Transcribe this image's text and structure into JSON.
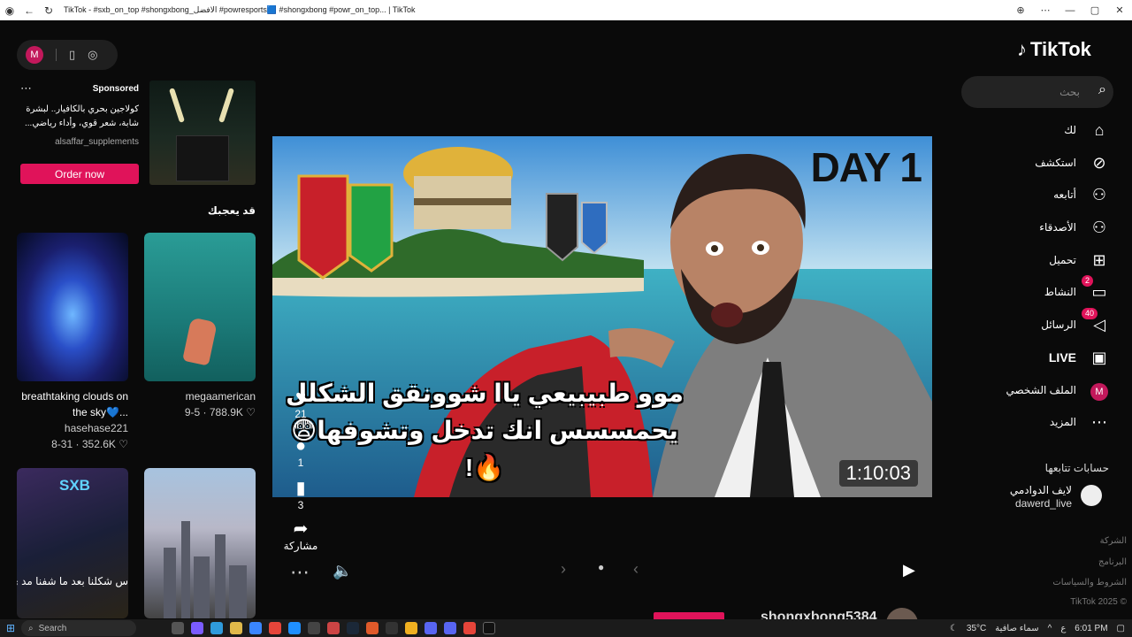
{
  "browser": {
    "title": "TikTok - #sxb_on_top #shongxbong_الافضل #powresports🟦 #shongxbong #powr_on_top... | TikTok",
    "icons": [
      "tiktok-app-icon",
      "back-icon",
      "refresh-icon",
      "zoom-icon",
      "more-icon",
      "minimize-icon",
      "restore-icon",
      "close-icon"
    ]
  },
  "top_pill": {
    "avatar_initial": "M"
  },
  "ad": {
    "sponsored": "Sponsored",
    "description": "كولاجين بحري بالكافيار.. لبشرة شابة، شعر قوي، وأداء رياضي...",
    "brand": "alsaffar_supplements",
    "cta": "Order now"
  },
  "suggested": {
    "title": "قد يعجبك",
    "items": [
      {
        "caption": "breathtaking clouds on the sky💙...",
        "author": "hasehase221",
        "date": "8-31",
        "likes": "352.6K"
      },
      {
        "caption": "megaamerican",
        "author": "",
        "date": "9-5",
        "likes": "788.9K"
      },
      {
        "caption": "س شكلنا بعد ما شفنا مد ي وشونق حاول يرقع😂",
        "author": "",
        "date": "",
        "likes": "",
        "logo": "SXB"
      },
      {
        "caption": "",
        "author": "",
        "date": "",
        "likes": ""
      }
    ]
  },
  "video": {
    "overlay_day": "DAY 1",
    "overlay_title": "موو طبيبيعي ياا شوونقق الشكلل يحمسسس انك تدخل وتشوفها😨🔥!",
    "duration": "1:10:03"
  },
  "actions": {
    "likes": "21",
    "comments": "1",
    "saves": "3",
    "share_label": "مشاركة"
  },
  "profile_bar": {
    "username": "shongxbong5384"
  },
  "sidebar": {
    "logo": "TikTok",
    "search_placeholder": "بحث",
    "nav": [
      {
        "label": "لك",
        "icon": "home-icon",
        "glyph": "⌂"
      },
      {
        "label": "استكشف",
        "icon": "compass-icon",
        "glyph": "⊘"
      },
      {
        "label": "أتابعه",
        "icon": "following-icon",
        "glyph": "⚇"
      },
      {
        "label": "الأصدقاء",
        "icon": "friends-icon",
        "glyph": "⚇"
      },
      {
        "label": "تحميل",
        "icon": "upload-icon",
        "glyph": "⊞"
      },
      {
        "label": "النشاط",
        "icon": "activity-icon",
        "glyph": "▭",
        "badge": "2"
      },
      {
        "label": "الرسائل",
        "icon": "messages-icon",
        "glyph": "◁",
        "badge": "40"
      },
      {
        "label": "LIVE",
        "icon": "live-icon",
        "glyph": "▣"
      },
      {
        "label": "الملف الشخصي",
        "icon": "profile-avatar-icon",
        "glyph": "M"
      },
      {
        "label": "المزيد",
        "icon": "more-icon",
        "glyph": "⋯"
      }
    ],
    "following_title": "حسابات تتابعها",
    "followed_account": {
      "display_name": "لايف الدوادمي",
      "handle": "dawerd_live"
    },
    "footer": [
      "الشركة",
      "البرنامج",
      "الشروط والسياسات",
      "TikTok 2025 ©"
    ]
  },
  "taskbar": {
    "search": "Search",
    "temp": "35°C",
    "weather": "سماء صافية",
    "lang": "ع",
    "time": "6:01 PM"
  }
}
